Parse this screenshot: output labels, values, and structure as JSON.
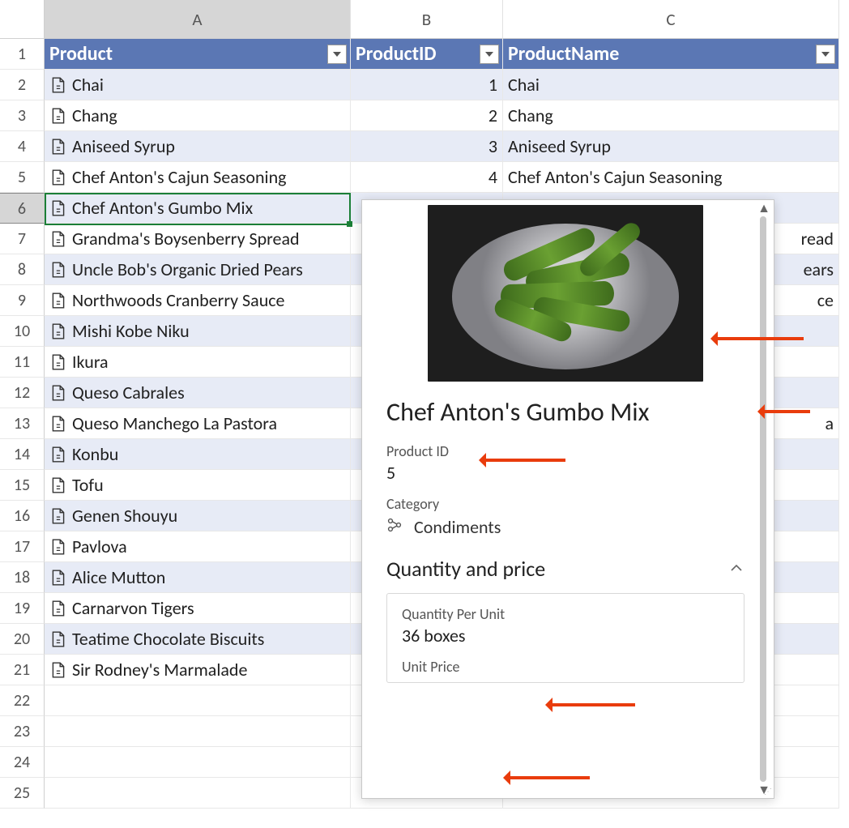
{
  "columns": {
    "A": "A",
    "B": "B",
    "C": "C"
  },
  "colWidths": {
    "A": 378,
    "B": 188,
    "C": 415
  },
  "headers": {
    "A": "Product",
    "B": "ProductID",
    "C": "ProductName"
  },
  "selected": {
    "cell": "A6",
    "row": 6,
    "col": "A"
  },
  "rows": [
    {
      "n": 2,
      "product": "Chai",
      "id": "1",
      "name": "Chai",
      "band": true
    },
    {
      "n": 3,
      "product": "Chang",
      "id": "2",
      "name": "Chang",
      "band": false
    },
    {
      "n": 4,
      "product": "Aniseed Syrup",
      "id": "3",
      "name": "Aniseed Syrup",
      "band": true
    },
    {
      "n": 5,
      "product": "Chef Anton's Cajun Seasoning",
      "id": "4",
      "name": "Chef Anton's Cajun Seasoning",
      "band": false
    },
    {
      "n": 6,
      "product": "Chef Anton's Gumbo Mix",
      "id": "",
      "name": "",
      "band": true
    },
    {
      "n": 7,
      "product": "Grandma's Boysenberry Spread",
      "id": "",
      "name_suffix": "read",
      "band": false
    },
    {
      "n": 8,
      "product": "Uncle Bob's Organic Dried Pears",
      "id": "",
      "name_suffix": "ears",
      "band": true
    },
    {
      "n": 9,
      "product": "Northwoods Cranberry Sauce",
      "id": "",
      "name_suffix": "ce",
      "band": false
    },
    {
      "n": 10,
      "product": "Mishi Kobe Niku",
      "id": "",
      "name": "",
      "band": true
    },
    {
      "n": 11,
      "product": "Ikura",
      "id": "",
      "name": "",
      "band": false
    },
    {
      "n": 12,
      "product": "Queso Cabrales",
      "id": "",
      "name": "",
      "band": true
    },
    {
      "n": 13,
      "product": "Queso Manchego La Pastora",
      "id": "",
      "name_suffix": "a",
      "band": false
    },
    {
      "n": 14,
      "product": "Konbu",
      "id": "",
      "name": "",
      "band": true
    },
    {
      "n": 15,
      "product": "Tofu",
      "id": "",
      "name": "",
      "band": false
    },
    {
      "n": 16,
      "product": "Genen Shouyu",
      "id": "",
      "name": "",
      "band": true
    },
    {
      "n": 17,
      "product": "Pavlova",
      "id": "",
      "name": "",
      "band": false
    },
    {
      "n": 18,
      "product": "Alice Mutton",
      "id": "",
      "name": "",
      "band": true
    },
    {
      "n": 19,
      "product": "Carnarvon Tigers",
      "id": "",
      "name": "",
      "band": false
    },
    {
      "n": 20,
      "product": "Teatime Chocolate Biscuits",
      "id": "",
      "name": "",
      "band": true
    },
    {
      "n": 21,
      "product": "Sir Rodney's Marmalade",
      "id": "",
      "name": "",
      "band": false
    }
  ],
  "emptyRows": [
    22,
    23,
    24,
    25
  ],
  "card": {
    "title": "Chef Anton's Gumbo Mix",
    "image_alt": "Bowl of okra",
    "fields": {
      "product_id": {
        "label": "Product ID",
        "value": "5"
      },
      "category": {
        "label": "Category",
        "value": "Condiments"
      }
    },
    "section": {
      "title": "Quantity and price",
      "expanded": true
    },
    "box": {
      "qpu": {
        "label": "Quantity Per Unit",
        "value": "36 boxes"
      },
      "unit_price": {
        "label": "Unit Price",
        "value": ""
      }
    }
  },
  "annotations": {
    "color": "#e93c0c"
  }
}
